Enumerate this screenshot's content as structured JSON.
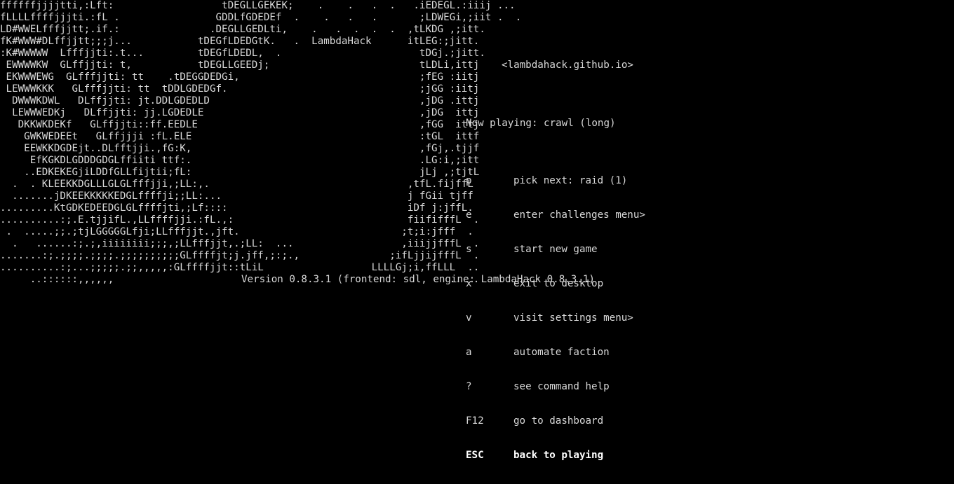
{
  "game": {
    "title": "LambdaHack",
    "url": "<lambdahack.github.io>",
    "now_playing": "Now playing: crawl (long)",
    "version": "Version 0.8.3.1 (frontend: sdl, engine: LambdaHack 0.8.3.1)"
  },
  "menu": {
    "items": [
      {
        "key": "p",
        "label": "pick next: raid (1)"
      },
      {
        "key": "e",
        "label": "enter challenges menu>"
      },
      {
        "key": "s",
        "label": "start new game"
      },
      {
        "key": "x",
        "label": "exit to desktop"
      },
      {
        "key": "v",
        "label": "visit settings menu>"
      },
      {
        "key": "a",
        "label": "automate faction"
      },
      {
        "key": "?",
        "label": "see command help"
      },
      {
        "key": "F12",
        "label": "go to dashboard"
      },
      {
        "key": "ESC",
        "label": "back to playing"
      }
    ]
  },
  "art_rows": [
    "ffffffjjjjtti,:Lft:                  tDEGLLGEKEK;    .    .   .  .   .iEDEGL.:iiij ...",
    "fLLLLffffjjjti.:fL .                GDDLfGDEDEf  .    .   .   .       ;LDWEGi,;iit .  .",
    "LD#WWELfffjjtt;.if.:               .DEGLLGEDLti,    .   .  .  .  .  ,tLKDG ,;itt.",
    "fK#WWW#DLffjjtt;;;j...           tDEGfLDEDGtK.   .  LambdaHack      itLEG:;jitt.",
    ":K#WWWWW  Lfffjjti:.t...         tDEGfLDEDL,  .                       tDGj.;jitt.",
    " EWWWWKW  GLffjjti: t,           tDEGLLGEEDj;                         tLDLi,ittj",
    " EKWWWEWG  GLfffjjti: tt    .tDEGGDEDGi,                              ;fEG :iitj",
    " LEWWWKKK   GLfffjjti: tt  tDDLGDEDGf.                                ;jGG :iitj",
    "  DWWWKDWL   DLffjjti: jt.DDLGDEDLD                                   ,jDG .ittj",
    "  LEWWWEDKj   DLffjjti: jj.LGDEDLE                                    ,jDG  ittj",
    "   DKKWKDEKf   GLffjjti::ff.EEDLE                                     ,fGG  ittj",
    "    GWKWEDEEt   GLffjjji :fL.ELE                                      :tGL  ittf",
    "    EEWKKDGDEjt..DLfftjji.,fG:K,                                      ,fGj,.tjjf",
    "     EfKGKDLGDDDGDGLffiiti ttf:.                                      .LG:i,;itt",
    "    ..EDKEKEGjiLDDfGLLfijtii;fL:                                      jLj ,;tjtL",
    "  .  . KLEEKKDGLLLGLGLfffjji,;LL:,.                                 ,tfL.fijffL",
    "  .......jDKEEKKKKKEDGLffffji;;LL:...                               j fGii tjff",
    ".........KtGDKEDEEDGLGLffffjti,;Lf::::                              iDf j:jffL.",
    "..........:;.E.tjjifL.,LLffffjji.:fL.,:                             fiififffL  .",
    " .  .....;;.;tjLGGGGGLfji;LLfffjjt.,jft.                           ;t;i:jfff  .",
    "  .   ......:;.;,iiiiiiii;;;,;LLfffjjt,.;LL:  ...                  ,iiijjfffL  .",
    ".......:;.;;;;.;;;;.;;;;;;;;;;GLffffjt;j.jff,;:;.,               ;ifLjjijfffL  .",
    "..........:;...;;;;;.;;,,,,,:GLffffjjt::tLiL                  LLLLGj;i,ffLLL  ..",
    "     ..::::::,,,,,,                                                        ..  ."
  ]
}
